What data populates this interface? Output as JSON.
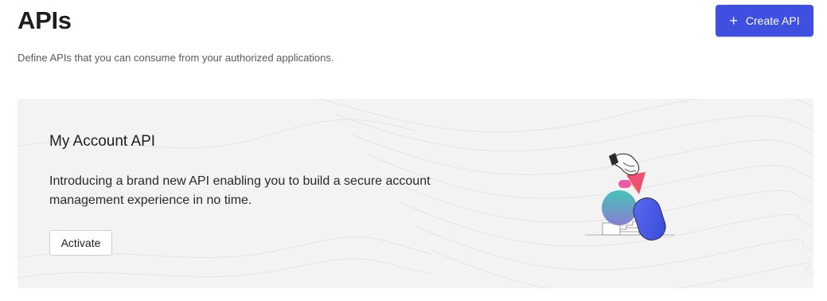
{
  "header": {
    "title": "APIs",
    "create_button_label": "Create API",
    "create_button_icon": "plus-icon",
    "subtitle": "Define APIs that you can consume from your authorized applications."
  },
  "promo_card": {
    "title": "My Account API",
    "description": "Introducing a brand new API enabling you to build a secure account management experience in no time.",
    "activate_label": "Activate",
    "illustration": "account-api-illustration"
  },
  "colors": {
    "accent": "#3f4fe0",
    "card_background": "#f3f3f3"
  }
}
